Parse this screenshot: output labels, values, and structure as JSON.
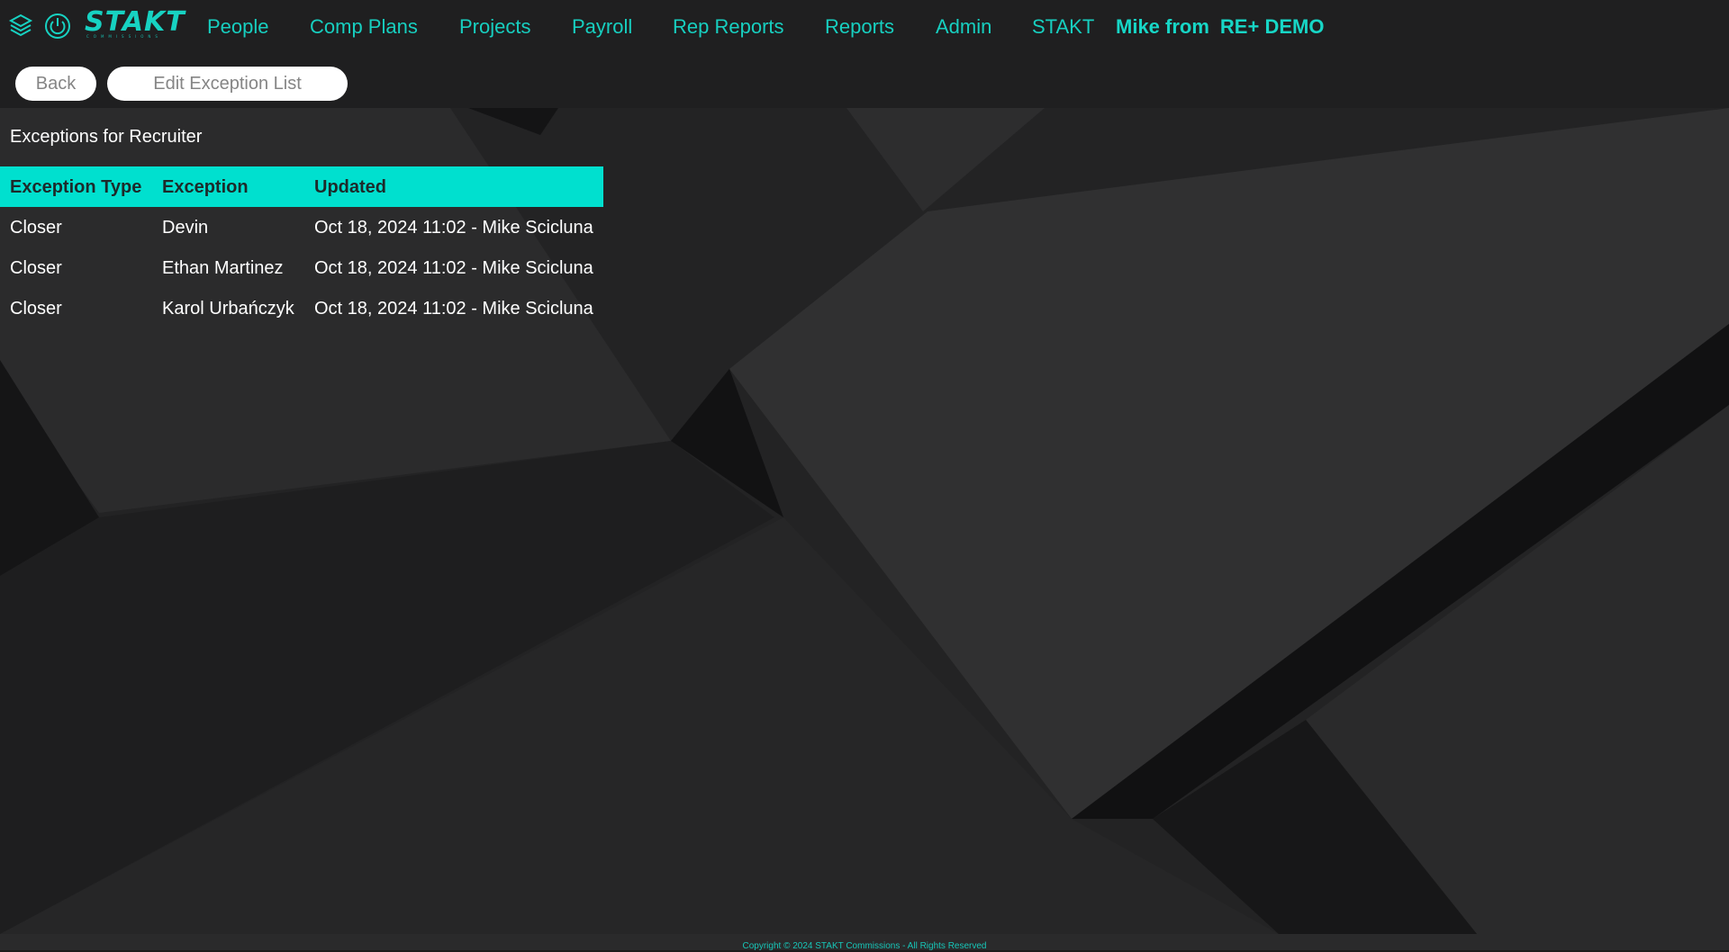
{
  "brand": {
    "name": "STAKT",
    "subtitle": "COMMISSIONS",
    "accent_color": "#17d2c2",
    "icons": [
      "layers-stack-icon",
      "power-icon"
    ]
  },
  "nav": {
    "items": [
      {
        "label": "People"
      },
      {
        "label": "Comp Plans"
      },
      {
        "label": "Projects"
      },
      {
        "label": "Payroll"
      },
      {
        "label": "Rep Reports"
      },
      {
        "label": "Reports"
      },
      {
        "label": "Admin"
      },
      {
        "label": "STAKT"
      }
    ],
    "user": "Mike from",
    "company": "RE+ DEMO"
  },
  "actions": {
    "back_label": "Back",
    "edit_label": "Edit Exception List"
  },
  "page": {
    "title": "Exceptions for Recruiter"
  },
  "table": {
    "header_color": "#00e0cf",
    "columns": [
      "Exception Type",
      "Exception",
      "Updated"
    ],
    "rows": [
      {
        "type": "Closer",
        "exception": "Devin",
        "updated": "Oct 18, 2024 11:02 - Mike Scicluna"
      },
      {
        "type": "Closer",
        "exception": "Ethan Martinez",
        "updated": "Oct 18, 2024 11:02 - Mike Scicluna"
      },
      {
        "type": "Closer",
        "exception": "Karol Urbańczyk",
        "updated": "Oct 18, 2024 11:02 - Mike Scicluna"
      }
    ]
  },
  "footer": {
    "text": "Copyright © 2024 STAKT Commissions - All Rights Reserved"
  }
}
